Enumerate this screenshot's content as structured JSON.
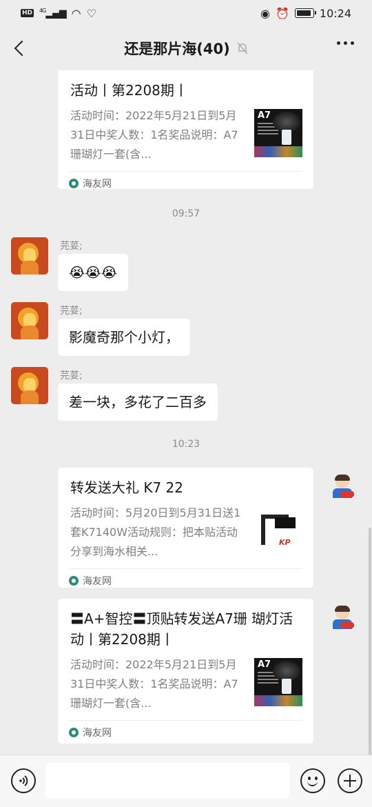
{
  "status_bar": {
    "hd": "HD",
    "network": "4G",
    "time": "10:24",
    "battery_level": 0.85
  },
  "header": {
    "title": "还是那片海(40)",
    "icons": [
      "back-icon",
      "mute-bell-icon",
      "more-icon"
    ]
  },
  "messages": [
    {
      "type": "card",
      "side": "right",
      "title": "活动丨第2208期丨",
      "desc": "活动时间：2022年5月21日到5月31日中奖人数：1名奖品说明：A7珊瑚灯一套(含...",
      "source": "海友网",
      "thumb_label": "A7"
    },
    {
      "type": "time",
      "text": "09:57"
    },
    {
      "type": "text",
      "side": "left",
      "sender": "芫荽;",
      "content": "😭😭😭"
    },
    {
      "type": "text",
      "side": "left",
      "sender": "芫荽;",
      "content": "影魔奇那个小灯，"
    },
    {
      "type": "text",
      "side": "left",
      "sender": "芫荽;",
      "content": "差一块，多花了二百多"
    },
    {
      "type": "time",
      "text": "10:23"
    },
    {
      "type": "card",
      "side": "right",
      "title": "转发送大礼 K7 22",
      "desc": "活动时间：5月20日到5月31日送1套K7140W活动规则：把本贴活动分享到海水相关...",
      "source": "海友网",
      "thumb_label": "KP"
    },
    {
      "type": "card",
      "side": "right",
      "title": "〓A+智控〓顶贴转发送A7珊 瑚灯活动丨第2208期丨",
      "desc": "活动时间：2022年5月21日到5月31日中奖人数：1名奖品说明：A7珊瑚灯一套(含...",
      "source": "海友网",
      "thumb_label": "A7"
    }
  ],
  "input_bar": {
    "icons": [
      "voice-icon",
      "emoji-icon",
      "plus-icon"
    ],
    "text": ""
  }
}
